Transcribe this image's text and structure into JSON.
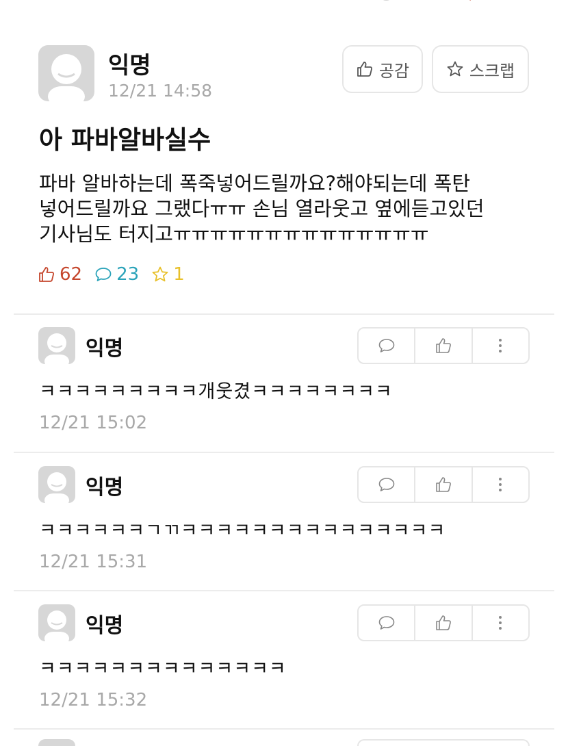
{
  "post": {
    "author": "익명",
    "time": "12/21 14:58",
    "like_label": "공감",
    "scrap_label": "스크랩",
    "title": "아 파바알바실수",
    "body": "파바 알바하는데 폭죽넣어드릴까요?해야되는데 폭탄\n넣어드릴까요 그랬다ㅠㅠ 손님 열라웃고 옆에듣고있던\n기사님도 터지고ㅠㅠㅠㅠㅠㅠㅠㅠㅠㅠㅠㅠㅠㅠ",
    "stats": {
      "likes": "62",
      "comments": "23",
      "scraps": "1"
    }
  },
  "comments": [
    {
      "author": "익명",
      "text": "ㅋㅋㅋㅋㅋㅋㅋㅋㅋ개웃겼ㅋㅋㅋㅋㅋㅋㅋㅋ",
      "time": "12/21 15:02"
    },
    {
      "author": "익명",
      "text": "ㅋㅋㅋㅋㅋㅋㄱㄲㅋㅋㅋㅋㅋㅋㅋㅋㅋㅋㅋㅋㅋㅋㅋ",
      "time": "12/21 15:31"
    },
    {
      "author": "익명",
      "text": "ㅋㅋㅋㅋㅋㅋㅋㅋㅋㅋㅋㅋㅋㅋ",
      "time": "12/21 15:32"
    }
  ],
  "icons": {
    "like": "thumbs-up-icon",
    "scrap": "star-icon",
    "comment": "speech-bubble-icon",
    "more": "more-vertical-icon"
  },
  "colors": {
    "like": "#c5462c",
    "comment": "#2aa3b9",
    "scrap": "#e8c02a",
    "muted": "#a8a8a8",
    "border": "#e6e6e6"
  }
}
